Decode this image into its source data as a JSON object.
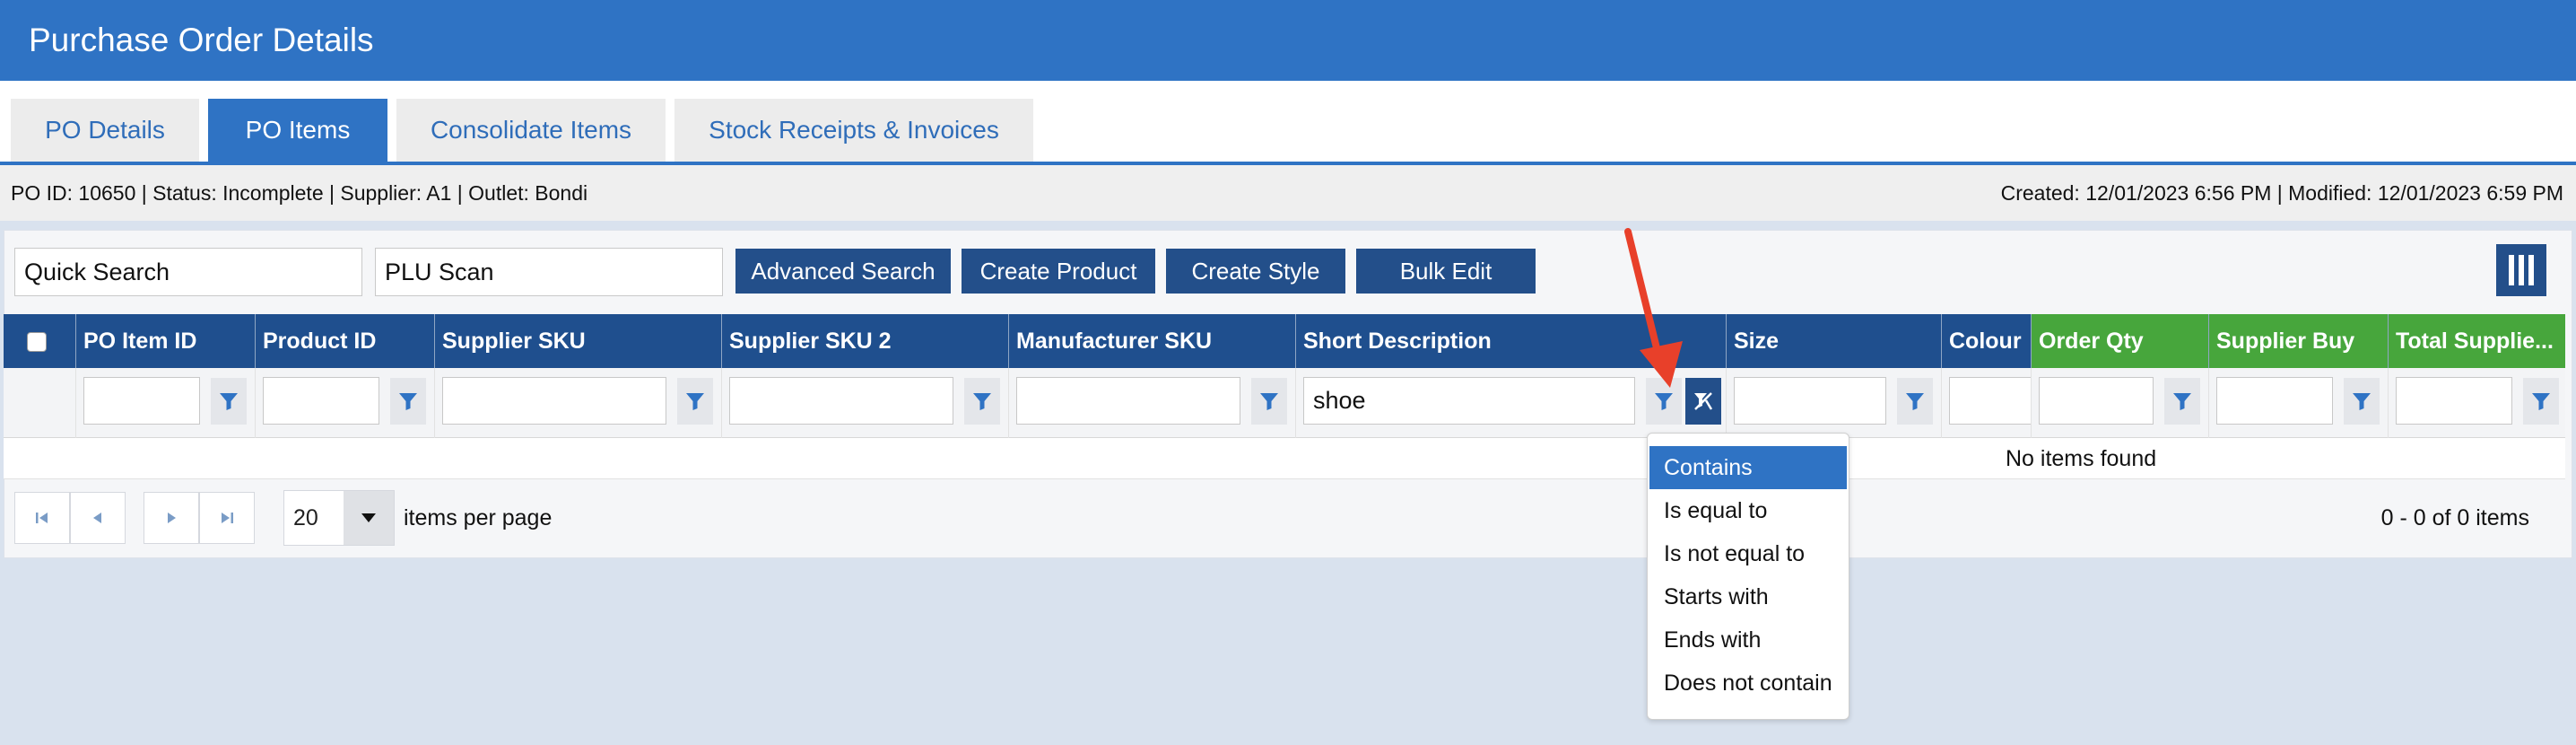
{
  "header": {
    "title": "Purchase Order Details"
  },
  "tabs": [
    {
      "label": "PO Details",
      "active": false
    },
    {
      "label": "PO Items",
      "active": true
    },
    {
      "label": "Consolidate Items",
      "active": false
    },
    {
      "label": "Stock Receipts & Invoices",
      "active": false
    }
  ],
  "info": {
    "left": "PO ID: 10650 | Status: Incomplete | Supplier: A1 | Outlet: Bondi",
    "right": "Created: 12/01/2023 6:56 PM | Modified: 12/01/2023 6:59 PM"
  },
  "toolbar": {
    "quick_search_placeholder": "Quick Search",
    "plu_scan_placeholder": "PLU Scan",
    "advanced_search": "Advanced Search",
    "create_product": "Create Product",
    "create_style": "Create Style",
    "bulk_edit": "Bulk Edit"
  },
  "grid": {
    "columns": [
      "PO Item ID",
      "Product ID",
      "Supplier SKU",
      "Supplier SKU 2",
      "Manufacturer SKU",
      "Short Description",
      "Size",
      "Colour",
      "Order Qty",
      "Supplier Buy",
      "Total Supplie..."
    ],
    "filter_values": {
      "short_description": "shoe"
    },
    "empty_message": "No items found"
  },
  "pager": {
    "page_size": "20",
    "items_per_page": "items per page",
    "range": "0 - 0 of 0 items"
  },
  "filter_menu": {
    "options": [
      "Contains",
      "Is equal to",
      "Is not equal to",
      "Starts with",
      "Ends with",
      "Does not contain"
    ],
    "selected": "Contains"
  },
  "colors": {
    "header_blue": "#2f73c4",
    "grid_header": "#1f4f8e",
    "green_header": "#47a63c",
    "button_dark": "#234f8a",
    "annotation_arrow": "#e8402a"
  }
}
